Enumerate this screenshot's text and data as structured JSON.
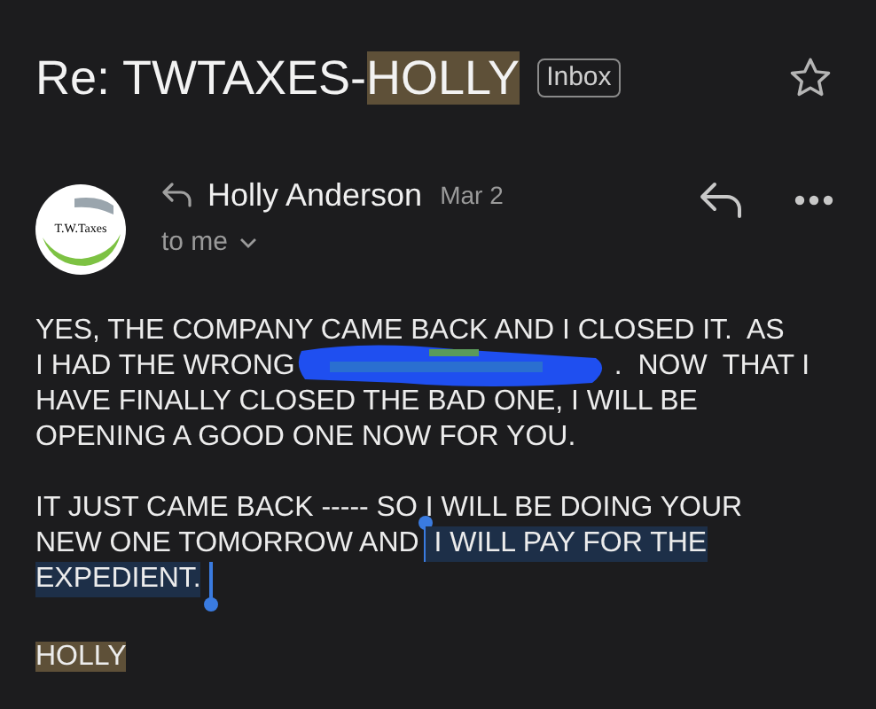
{
  "subject": {
    "parts": [
      {
        "text": "Re: TWTAXES-",
        "highlighted": false
      },
      {
        "text": "HOLLY",
        "highlighted": true
      }
    ],
    "label": "Inbox",
    "starred": false
  },
  "message": {
    "avatar_text": "T.W.Taxes",
    "sender": "Holly Anderson",
    "date": "Mar 2",
    "recipient": "to me"
  },
  "body": {
    "paragraphs": [
      {
        "lines": [
          [
            {
              "kind": "text",
              "text": "YES, THE COMPANY CAME BACK AND I CLOSED IT.  AS",
              "selected": false
            }
          ],
          [
            {
              "kind": "text",
              "text": "I HAD THE WRONG",
              "selected": false
            },
            {
              "kind": "redaction"
            },
            {
              "kind": "text",
              "text": ".  NOW  THAT I",
              "selected": false
            }
          ],
          [
            {
              "kind": "text",
              "text": "HAVE FINALLY CLOSED THE BAD ONE, I WILL BE",
              "selected": false
            }
          ],
          [
            {
              "kind": "text",
              "text": "OPENING A GOOD ONE NOW FOR YOU.",
              "selected": false
            }
          ]
        ]
      },
      {
        "lines": [
          [
            {
              "kind": "text",
              "text": "IT JUST CAME BACK ----- SO I WILL BE DOING YOUR",
              "selected": false
            }
          ],
          [
            {
              "kind": "text",
              "text": "NEW ONE TOMORROW AND",
              "selected": false
            },
            {
              "kind": "text",
              "text": " I WILL PAY FOR THE",
              "selected": true
            }
          ],
          [
            {
              "kind": "text",
              "text": "EXPEDIENT.",
              "selected": true
            }
          ]
        ]
      }
    ],
    "signature": {
      "text": "HOLLY",
      "highlighted": true
    }
  }
}
